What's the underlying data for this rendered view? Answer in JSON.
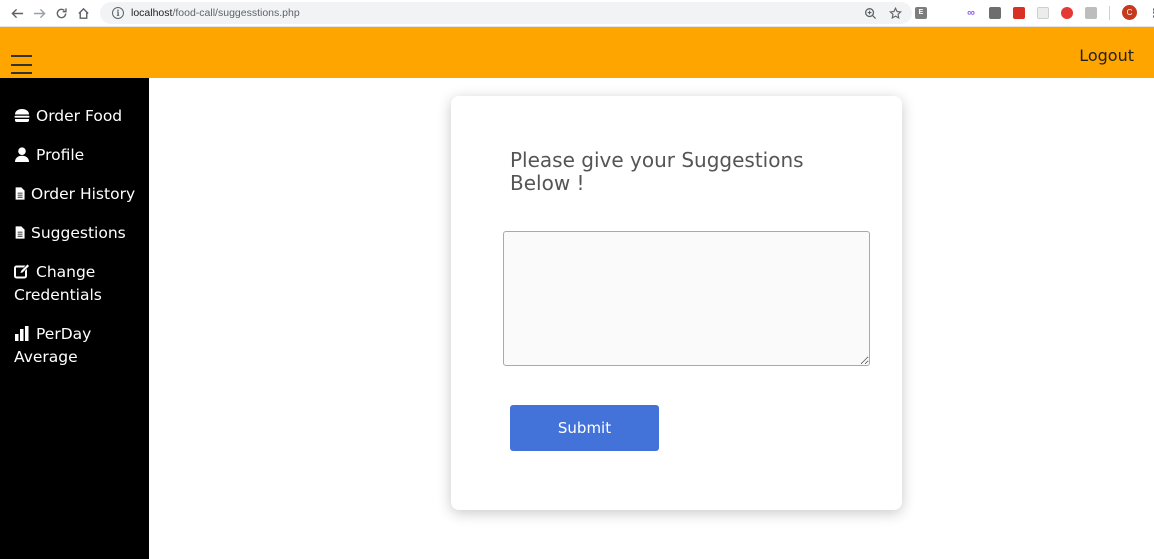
{
  "browser": {
    "url_host": "localhost",
    "url_path": "/food-call/suggesstions.php",
    "avatar_letter": "C",
    "extensions": [
      {
        "name": "e-extension-icon",
        "letter": "E",
        "color": "#7d7d7d"
      },
      {
        "name": "infinity-extension-icon",
        "letter": "∞",
        "color": "#8a5cf6"
      },
      {
        "name": "chat-extension-icon",
        "letter": "",
        "color": "#6e6e6e"
      },
      {
        "name": "red-box-extension-icon",
        "letter": "",
        "color": "#d93025"
      },
      {
        "name": "blank-extension-icon",
        "letter": "",
        "color": "#e8e8e8"
      },
      {
        "name": "opera-extension-icon",
        "letter": "",
        "color": "#e53935"
      },
      {
        "name": "tab-extension-icon",
        "letter": "",
        "color": "#9e9e9e"
      }
    ]
  },
  "header": {
    "logout_label": "Logout",
    "bg_color": "#ffa500"
  },
  "sidebar": {
    "items": [
      {
        "label": "Order Food",
        "icon": "burger-icon"
      },
      {
        "label": "Profile",
        "icon": "user-icon"
      },
      {
        "label": "Order History",
        "icon": "file-icon"
      },
      {
        "label": "Suggestions",
        "icon": "file-icon"
      },
      {
        "label": "Change Credentials",
        "icon": "edit-icon"
      },
      {
        "label": "PerDay Average",
        "icon": "bar-chart-icon"
      }
    ]
  },
  "card": {
    "title": "Please give your Suggestions Below !",
    "textarea_value": "",
    "submit_label": "Submit",
    "submit_color": "#4373d9"
  }
}
